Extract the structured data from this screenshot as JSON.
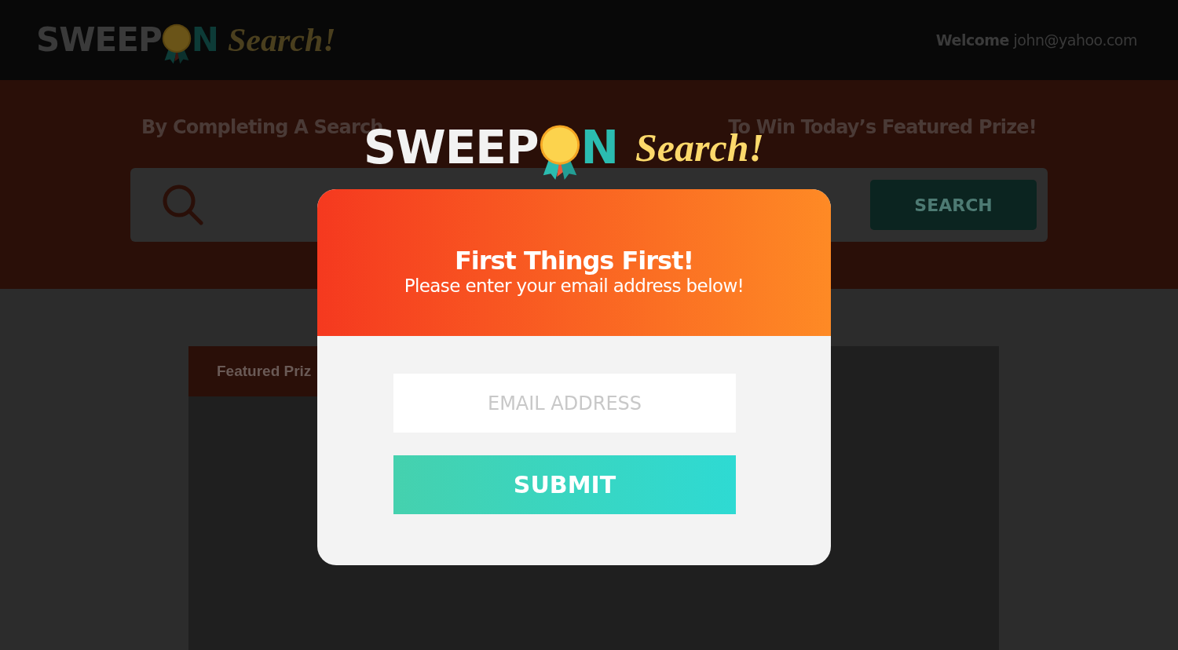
{
  "header": {
    "logo": {
      "word_start": "SWEEP",
      "word_end": "N",
      "script": "Search!"
    },
    "welcome_label": "Welcome",
    "welcome_email": "john@yahoo.com"
  },
  "hero": {
    "tagline_start": "By Completing A Search",
    "tagline_end": "To Win Today’s Featured Prize!",
    "search_button": "SEARCH"
  },
  "featured": {
    "tab": "Featured Priz"
  },
  "modal": {
    "logo": {
      "word_start": "SWEEP",
      "word_end": "N",
      "script": "Search!"
    },
    "title": "First Things First!",
    "subtitle": "Please enter your email address below!",
    "email": {
      "placeholder": "EMAIL ADDRESS"
    },
    "submit": "SUBMIT"
  }
}
